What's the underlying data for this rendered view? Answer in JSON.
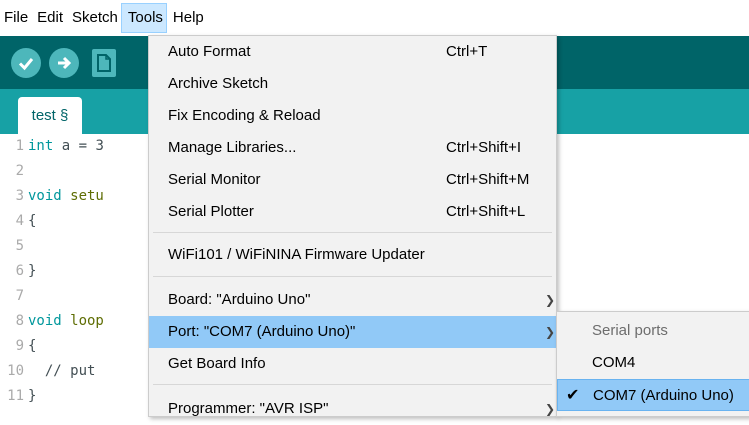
{
  "menubar": [
    "File",
    "Edit",
    "Sketch",
    "Tools",
    "Help"
  ],
  "tab": {
    "label": "test §"
  },
  "editor": {
    "lines": [
      {
        "n": "1",
        "parts": [
          [
            "kw",
            "int"
          ],
          [
            "code",
            " a = 3"
          ]
        ]
      },
      {
        "n": "2",
        "parts": []
      },
      {
        "n": "3",
        "parts": [
          [
            "kw",
            "void"
          ],
          [
            "fn",
            " setu"
          ]
        ]
      },
      {
        "n": "4",
        "parts": [
          [
            "code",
            "{"
          ]
        ]
      },
      {
        "n": "5",
        "parts": []
      },
      {
        "n": "6",
        "parts": [
          [
            "code",
            "}"
          ]
        ]
      },
      {
        "n": "7",
        "parts": []
      },
      {
        "n": "8",
        "parts": [
          [
            "kw",
            "void"
          ],
          [
            "fn",
            " loop"
          ]
        ]
      },
      {
        "n": "9",
        "parts": [
          [
            "code",
            "{"
          ]
        ]
      },
      {
        "n": "10",
        "parts": [
          [
            "code",
            "  // put"
          ]
        ]
      },
      {
        "n": "11",
        "parts": [
          [
            "code",
            "}"
          ]
        ]
      }
    ]
  },
  "tools_menu": {
    "items": [
      {
        "label": "Auto Format",
        "shortcut": "Ctrl+T"
      },
      {
        "label": "Archive Sketch",
        "shortcut": ""
      },
      {
        "label": "Fix Encoding & Reload",
        "shortcut": ""
      },
      {
        "label": "Manage Libraries...",
        "shortcut": "Ctrl+Shift+I"
      },
      {
        "label": "Serial Monitor",
        "shortcut": "Ctrl+Shift+M"
      },
      {
        "label": "Serial Plotter",
        "shortcut": "Ctrl+Shift+L"
      },
      {
        "label": "WiFi101 / WiFiNINA Firmware Updater",
        "shortcut": ""
      },
      {
        "label": "Board: \"Arduino Uno\"",
        "shortcut": ""
      },
      {
        "label": "Port: \"COM7 (Arduino Uno)\"",
        "shortcut": ""
      },
      {
        "label": "Get Board Info",
        "shortcut": ""
      },
      {
        "label": "Programmer: \"AVR ISP\"",
        "shortcut": ""
      }
    ]
  },
  "port_submenu": {
    "header": "Serial ports",
    "items": [
      {
        "label": "COM4",
        "checked": false
      },
      {
        "label": "COM7 (Arduino Uno)",
        "checked": true
      }
    ]
  },
  "colors": {
    "toolbar": "#006468",
    "tabstrip": "#17a1a5",
    "menu_highlight": "#91c9f7"
  }
}
